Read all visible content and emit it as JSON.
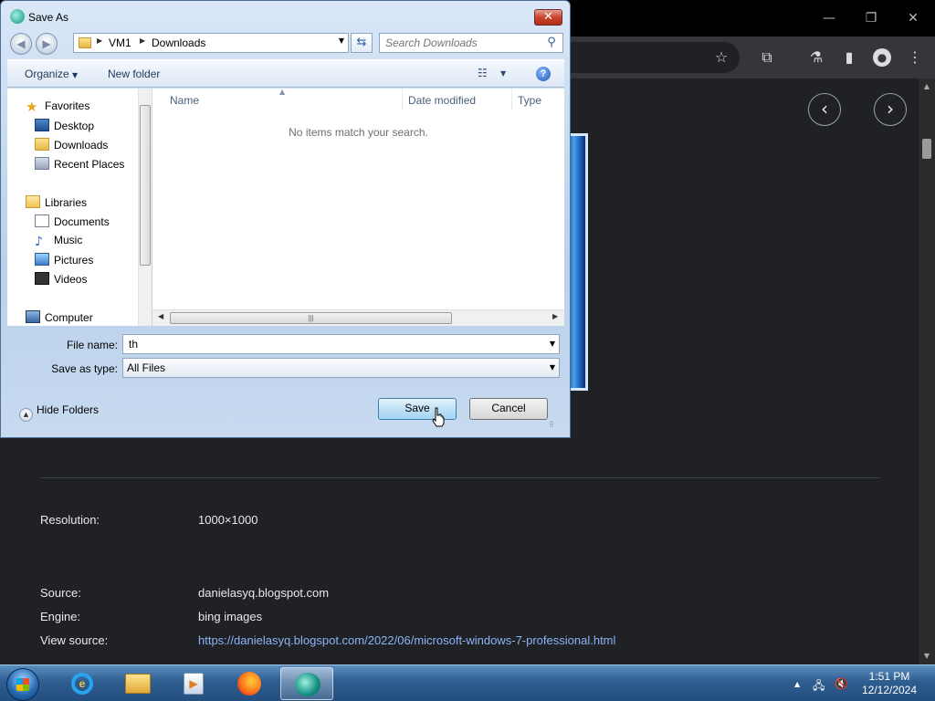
{
  "dialog": {
    "title": "Save As",
    "close_label": "✕",
    "address": [
      "VM1",
      "Downloads"
    ],
    "search_placeholder": "Search Downloads",
    "toolbar": {
      "organize": "Organize",
      "new_folder": "New folder"
    },
    "nav": {
      "favorites_header": "Favorites",
      "favorites": [
        "Desktop",
        "Downloads",
        "Recent Places"
      ],
      "libraries_header": "Libraries",
      "libraries": [
        "Documents",
        "Music",
        "Pictures",
        "Videos"
      ],
      "computer": "Computer"
    },
    "columns": {
      "name": "Name",
      "date_modified": "Date modified",
      "type": "Type"
    },
    "empty_message": "No items match your search.",
    "file_name_label": "File name:",
    "file_name_value": "th",
    "save_type_label": "Save as type:",
    "save_type_value": "All Files",
    "hide_folders": "Hide Folders",
    "save_button": "Save",
    "cancel_button": "Cancel"
  },
  "browser": {
    "image_info": [
      {
        "label": "Resolution:",
        "value": "1000×1000"
      },
      {
        "label": "Source:",
        "value": "danielasyq.blogspot.com"
      },
      {
        "label": "Engine:",
        "value": "bing images"
      },
      {
        "label": "View source:",
        "value": "https://danielasyq.blogspot.com/2022/06/microsoft-windows-7-professional.html"
      }
    ]
  },
  "taskbar": {
    "time": "1:51 PM",
    "date": "12/12/2024"
  },
  "colors": {
    "page_bg": "#202124",
    "link": "#8ab4f8",
    "taskbar": "#2e5d8f"
  }
}
